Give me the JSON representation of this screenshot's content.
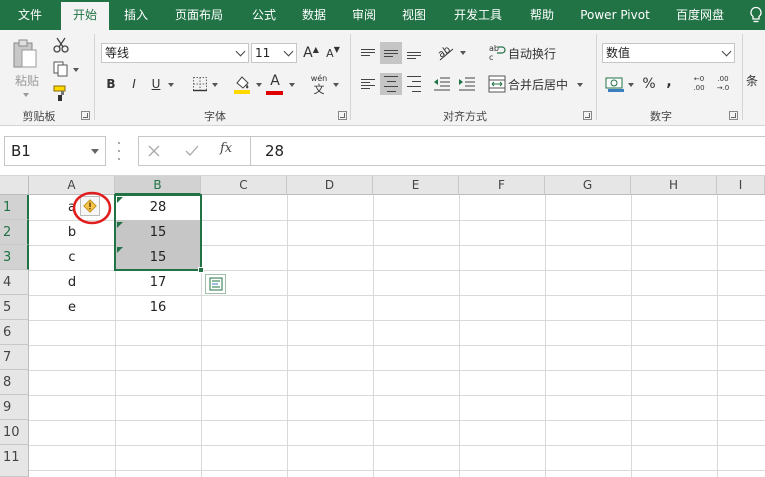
{
  "tabs": [
    {
      "label": "文件",
      "active": false
    },
    {
      "label": "开始",
      "active": true
    },
    {
      "label": "插入",
      "active": false
    },
    {
      "label": "页面布局",
      "active": false
    },
    {
      "label": "公式",
      "active": false
    },
    {
      "label": "数据",
      "active": false
    },
    {
      "label": "审阅",
      "active": false
    },
    {
      "label": "视图",
      "active": false
    },
    {
      "label": "开发工具",
      "active": false
    },
    {
      "label": "帮助",
      "active": false
    },
    {
      "label": "Power Pivot",
      "active": false
    },
    {
      "label": "百度网盘",
      "active": false
    }
  ],
  "ribbon": {
    "clipboard": {
      "paste_label": "粘贴",
      "group_label": "剪贴板"
    },
    "font": {
      "font_name": "等线",
      "font_size": "11",
      "bold": "B",
      "italic": "I",
      "underline": "U",
      "font_color_glyph": "A",
      "phonetic_top": "wén",
      "phonetic_bottom": "文",
      "grow": "A",
      "shrink": "A",
      "group_label": "字体"
    },
    "alignment": {
      "wrap_text": "自动换行",
      "merge_center": "合并后居中",
      "group_label": "对齐方式"
    },
    "number": {
      "format": "数值",
      "percent": "%",
      "comma": ",",
      "inc_decimal_top": "←0",
      "inc_decimal_bottom": ".00",
      "dec_decimal_top": ".00",
      "dec_decimal_bottom": "→.0",
      "group_label": "数字"
    },
    "styles": {
      "partial_label": "条"
    }
  },
  "colors": {
    "accent": "#217346",
    "font_color": "#e00000",
    "highlight": "#ffd800"
  },
  "formula_bar": {
    "name_box": "B1",
    "fx": "fx",
    "formula": "28"
  },
  "grid": {
    "columns": [
      "A",
      "B",
      "C",
      "D",
      "E",
      "F",
      "G",
      "H",
      "I"
    ],
    "rows": [
      "1",
      "2",
      "3",
      "4",
      "5",
      "6",
      "7",
      "8",
      "9",
      "10",
      "11"
    ],
    "col_a": [
      "a",
      "b",
      "c",
      "d",
      "e"
    ],
    "col_b": [
      "28",
      "15",
      "15",
      "17",
      "16"
    ]
  }
}
